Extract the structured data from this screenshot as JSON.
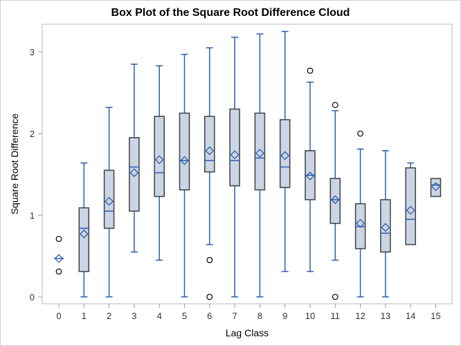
{
  "chart_data": {
    "type": "box",
    "title": "Box Plot of the Square Root Difference Cloud",
    "xlabel": "Lag Class",
    "ylabel": "Square Root Difference",
    "ylim": [
      -0.1,
      3.33
    ],
    "yticks": [
      0,
      1,
      2,
      3
    ],
    "categories": [
      "0",
      "1",
      "2",
      "3",
      "4",
      "5",
      "6",
      "7",
      "8",
      "9",
      "10",
      "11",
      "12",
      "13",
      "14",
      "15"
    ],
    "boxes": [
      {
        "cat": "0",
        "min": 0.47,
        "q1": 0.47,
        "median": 0.47,
        "q3": 0.47,
        "max": 0.47,
        "mean": 0.47,
        "outliers": [
          0.71,
          0.31
        ]
      },
      {
        "cat": "1",
        "min": 0.0,
        "q1": 0.31,
        "median": 0.84,
        "q3": 1.09,
        "max": 1.64,
        "mean": 0.77,
        "outliers": []
      },
      {
        "cat": "2",
        "min": 0.0,
        "q1": 0.84,
        "median": 1.05,
        "q3": 1.55,
        "max": 2.32,
        "mean": 1.17,
        "outliers": []
      },
      {
        "cat": "3",
        "min": 0.55,
        "q1": 1.05,
        "median": 1.59,
        "q3": 1.95,
        "max": 2.85,
        "mean": 1.52,
        "outliers": []
      },
      {
        "cat": "4",
        "min": 0.45,
        "q1": 1.23,
        "median": 1.52,
        "q3": 2.21,
        "max": 2.83,
        "mean": 1.68,
        "outliers": []
      },
      {
        "cat": "5",
        "min": 0.0,
        "q1": 1.31,
        "median": 1.67,
        "q3": 2.25,
        "max": 2.97,
        "mean": 1.67,
        "outliers": []
      },
      {
        "cat": "6",
        "min": 0.64,
        "q1": 1.53,
        "median": 1.67,
        "q3": 2.21,
        "max": 3.05,
        "mean": 1.79,
        "outliers": [
          0.45,
          0.0
        ]
      },
      {
        "cat": "7",
        "min": 0.0,
        "q1": 1.36,
        "median": 1.67,
        "q3": 2.3,
        "max": 3.18,
        "mean": 1.74,
        "outliers": []
      },
      {
        "cat": "8",
        "min": 0.0,
        "q1": 1.31,
        "median": 1.7,
        "q3": 2.25,
        "max": 3.22,
        "mean": 1.76,
        "outliers": []
      },
      {
        "cat": "9",
        "min": 0.31,
        "q1": 1.34,
        "median": 1.59,
        "q3": 2.17,
        "max": 3.25,
        "mean": 1.73,
        "outliers": []
      },
      {
        "cat": "10",
        "min": 0.31,
        "q1": 1.19,
        "median": 1.49,
        "q3": 1.79,
        "max": 2.63,
        "mean": 1.48,
        "outliers": [
          2.77
        ]
      },
      {
        "cat": "11",
        "min": 0.45,
        "q1": 0.9,
        "median": 1.19,
        "q3": 1.45,
        "max": 2.28,
        "mean": 1.19,
        "outliers": [
          2.35,
          0.0
        ]
      },
      {
        "cat": "12",
        "min": 0.0,
        "q1": 0.59,
        "median": 0.86,
        "q3": 1.14,
        "max": 1.81,
        "mean": 0.9,
        "outliers": [
          2.0
        ]
      },
      {
        "cat": "13",
        "min": 0.0,
        "q1": 0.55,
        "median": 0.78,
        "q3": 1.19,
        "max": 1.79,
        "mean": 0.85,
        "outliers": []
      },
      {
        "cat": "14",
        "min": 0.64,
        "q1": 0.64,
        "median": 0.95,
        "q3": 1.58,
        "max": 1.64,
        "mean": 1.06,
        "outliers": []
      },
      {
        "cat": "15",
        "min": 1.23,
        "q1": 1.23,
        "median": 1.37,
        "q3": 1.45,
        "max": 1.45,
        "mean": 1.35,
        "outliers": []
      }
    ],
    "grid": false,
    "colors": {
      "box_fill": "#CAD5E5",
      "box_edge": "#3F3F3F",
      "whisker": "#2A5DB0",
      "mean_marker": "#2A5DB0",
      "outlier": "#000000"
    }
  }
}
